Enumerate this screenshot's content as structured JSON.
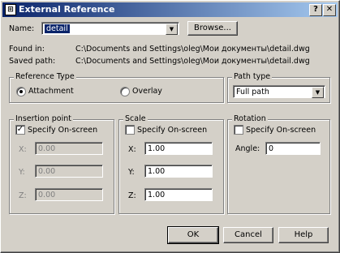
{
  "dialog": {
    "title": "External Reference",
    "help_glyph": "?",
    "close_glyph": "✕",
    "app_icon": "xref-app-icon"
  },
  "name_row": {
    "label": "Name:",
    "value": "detail",
    "browse_label": "Browse..."
  },
  "found_in": {
    "label": "Found in:",
    "value": "C:\\Documents and Settings\\oleg\\Мои документы\\detail.dwg"
  },
  "saved_path": {
    "label": "Saved path:",
    "value": "C:\\Documents and Settings\\oleg\\Мои документы\\detail.dwg"
  },
  "reference_type": {
    "title": "Reference Type",
    "options": [
      {
        "label": "Attachment",
        "selected": true
      },
      {
        "label": "Overlay",
        "selected": false
      }
    ]
  },
  "path_type": {
    "title": "Path type",
    "value": "Full path"
  },
  "insertion_point": {
    "title": "Insertion point",
    "specify_label": "Specify On-screen",
    "specify_checked": true,
    "x_label": "X:",
    "x_value": "0.00",
    "y_label": "Y:",
    "y_value": "0.00",
    "z_label": "Z:",
    "z_value": "0.00"
  },
  "scale": {
    "title": "Scale",
    "specify_label": "Specify On-screen",
    "specify_checked": false,
    "x_label": "X:",
    "x_value": "1.00",
    "y_label": "Y:",
    "y_value": "1.00",
    "z_label": "Z:",
    "z_value": "1.00"
  },
  "rotation": {
    "title": "Rotation",
    "specify_label": "Specify On-screen",
    "specify_checked": false,
    "angle_label": "Angle:",
    "angle_value": "0"
  },
  "buttons": {
    "ok": "OK",
    "cancel": "Cancel",
    "help": "Help"
  },
  "colors": {
    "title_start": "#0a246a",
    "title_end": "#a6caf0",
    "face": "#d4d0c8"
  }
}
